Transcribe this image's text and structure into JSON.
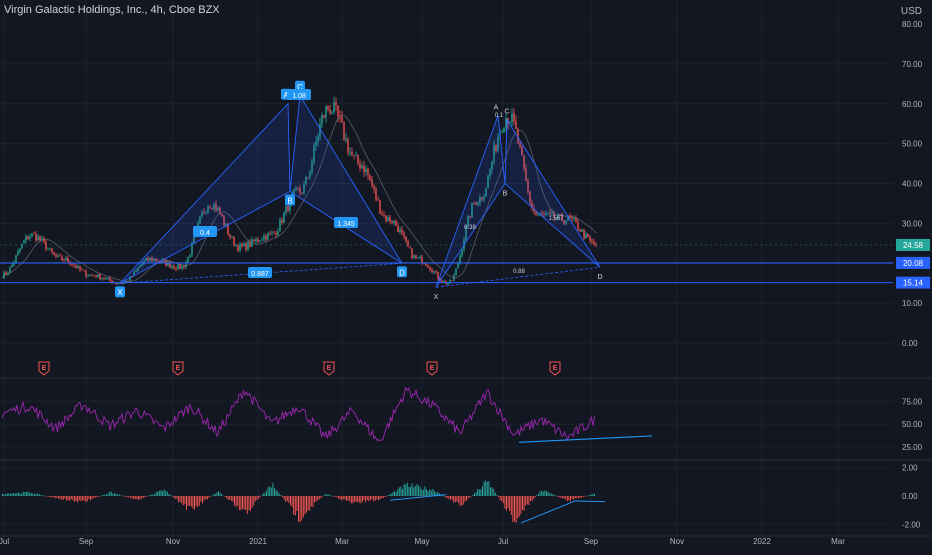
{
  "header": {
    "title": "Virgin Galactic Holdings, Inc., 4h, Cboe BZX",
    "currency": "USD"
  },
  "chart_data": {
    "type": "line",
    "symbol": "Virgin Galactic Holdings, Inc.",
    "interval": "4h",
    "exchange": "Cboe BZX",
    "x_axis_labels": [
      "Jul",
      "Sep",
      "Nov",
      "2021",
      "Mar",
      "May",
      "Jul",
      "Sep",
      "Nov",
      "2022",
      "Mar"
    ],
    "price_axis": {
      "ticks": [
        "80.00",
        "70.00",
        "60.00",
        "50.00",
        "40.00",
        "30.00",
        "10.00",
        "0.00"
      ],
      "ylim": [
        0,
        80
      ]
    },
    "price_badges": [
      {
        "label": "24.58",
        "value": 24.58,
        "color": "#26a69a"
      },
      {
        "label": "20.08",
        "value": 20.08,
        "color": "#2962ff"
      },
      {
        "label": "15.14",
        "value": 15.14,
        "color": "#2962ff"
      }
    ],
    "horizontal_lines": [
      20.08,
      15.14
    ],
    "price_series_anchors": [
      {
        "t": "Jul",
        "price": 17
      },
      {
        "t": "Jul/Aug",
        "price": 27
      },
      {
        "t": "Aug",
        "price": 21
      },
      {
        "t": "Sep",
        "price": 17
      },
      {
        "t": "Sep/Oct",
        "price": 15
      },
      {
        "t": "Oct",
        "price": 21
      },
      {
        "t": "Nov",
        "price": 19
      },
      {
        "t": "Nov/Dec",
        "price": 35
      },
      {
        "t": "Dec",
        "price": 24
      },
      {
        "t": "2021",
        "price": 27
      },
      {
        "t": "Jan",
        "price": 38
      },
      {
        "t": "Feb",
        "price": 59
      },
      {
        "t": "Feb/Mar",
        "price": 45
      },
      {
        "t": "Mar",
        "price": 31
      },
      {
        "t": "Apr",
        "price": 21
      },
      {
        "t": "May",
        "price": 15
      },
      {
        "t": "Jun",
        "price": 36
      },
      {
        "t": "Jul",
        "price": 57
      },
      {
        "t": "Jul/Aug",
        "price": 32
      },
      {
        "t": "Aug",
        "price": 31
      },
      {
        "t": "Sep",
        "price": 24.58
      }
    ],
    "patterns": [
      {
        "name": "left pattern",
        "points": [
          {
            "label": "X",
            "price": 15.0
          },
          {
            "label": "A",
            "price": 60.0
          },
          {
            "label": "B",
            "price": 38.0
          },
          {
            "label": "C",
            "price": 62.0
          },
          {
            "label": "D",
            "price": 20.0
          }
        ],
        "ratios": [
          {
            "label": "0.4",
            "between": "XA-AB"
          },
          {
            "label": "1.08",
            "between": "A-C"
          },
          {
            "label": "1.345",
            "between": "C-D"
          },
          {
            "label": "0.887",
            "between": "X-D"
          }
        ]
      },
      {
        "name": "right pattern",
        "points": [
          {
            "label": "X",
            "price": 14.0
          },
          {
            "label": "A",
            "price": 57.0
          },
          {
            "label": "B",
            "price": 40.0
          },
          {
            "label": "C",
            "price": 56.0
          },
          {
            "label": "D",
            "price": 19.0
          }
        ],
        "ratios": [
          {
            "label": "0.38",
            "between": "XA-AB"
          },
          {
            "label": "0.1",
            "between": "A-C"
          },
          {
            "label": "1.567",
            "between": "C-D"
          },
          {
            "label": "0.88",
            "between": "X-D"
          }
        ]
      }
    ],
    "earnings_markers": {
      "label": "E",
      "months": [
        "Aug",
        "Nov",
        "Feb",
        "May",
        "Aug"
      ]
    },
    "oscillator_rsi": {
      "ticks": [
        "75.00",
        "50.00",
        "25.00"
      ],
      "ylim": [
        15,
        95
      ],
      "color": "#9c27b0",
      "anchors": [
        62,
        70,
        45,
        72,
        48,
        65,
        45,
        70,
        40,
        88,
        50,
        70,
        35,
        65,
        30,
        88,
        70,
        40,
        85,
        38,
        55,
        35,
        55
      ],
      "trendline": [
        {
          "value": 30
        },
        {
          "value": 37
        }
      ]
    },
    "oscillator_macd": {
      "ticks": [
        "2.00",
        "0.00",
        "-2.00"
      ],
      "ylim": [
        -2.4,
        2.4
      ],
      "positive_color": "#26a69a",
      "negative_color": "#ef5350",
      "anchors": [
        0.2,
        0.3,
        -0.2,
        -0.5,
        0.3,
        -0.3,
        0.5,
        -1.2,
        0.4,
        -1.5,
        1.0,
        -1.8,
        0.2,
        -0.6,
        -0.3,
        0.9,
        0.5,
        -0.8,
        1.2,
        -2.0,
        0.5,
        -0.4,
        0.2
      ]
    }
  }
}
